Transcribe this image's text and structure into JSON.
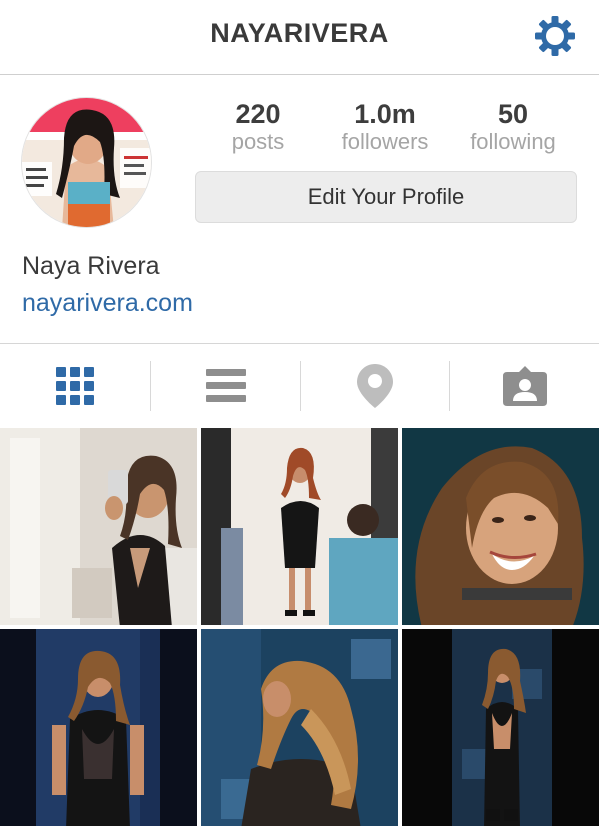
{
  "header": {
    "username": "NAYARIVERA",
    "settings_icon": "gear-icon",
    "accent_color": "#2f6aa7"
  },
  "profile": {
    "stats": [
      {
        "value": "220",
        "label": "posts"
      },
      {
        "value": "1.0m",
        "label": "followers"
      },
      {
        "value": "50",
        "label": "following"
      }
    ],
    "edit_button_label": "Edit Your Profile",
    "full_name": "Naya Rivera",
    "website": "nayarivera.com"
  },
  "tabs": [
    {
      "icon": "grid-view-icon",
      "active": true
    },
    {
      "icon": "list-view-icon",
      "active": false
    },
    {
      "icon": "location-pin-icon",
      "active": false
    },
    {
      "icon": "tagged-photos-icon",
      "active": false
    }
  ],
  "photos": [
    {
      "id": 1,
      "subject": "mirror selfie in black dress"
    },
    {
      "id": 2,
      "subject": "photo shoot in black dress"
    },
    {
      "id": 3,
      "subject": "close-up smiling portrait"
    },
    {
      "id": 4,
      "subject": "red carpet black dress"
    },
    {
      "id": 5,
      "subject": "back view wavy hair"
    },
    {
      "id": 6,
      "subject": "red carpet back view"
    }
  ]
}
